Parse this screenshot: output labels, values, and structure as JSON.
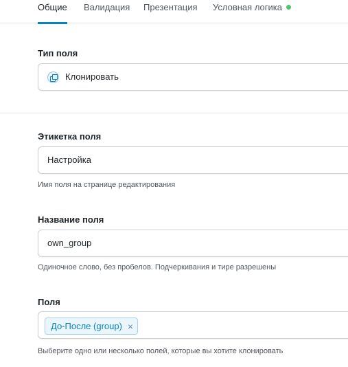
{
  "tabs": [
    {
      "label": "Общие",
      "active": true
    },
    {
      "label": "Валидация"
    },
    {
      "label": "Презентация"
    },
    {
      "label": "Условная логика",
      "status_dot": true
    }
  ],
  "field_type": {
    "label": "Тип поля",
    "value": "Клонировать",
    "icon": "clone-icon"
  },
  "field_label": {
    "label": "Этикетка поля",
    "value": "Настройка",
    "help": "Имя поля на странице редактирования"
  },
  "field_name": {
    "label": "Название поля",
    "value": "own_group",
    "help": "Одиночное слово, без пробелов. Подчеркивания и тире разрешены"
  },
  "fields": {
    "label": "Поля",
    "chips": [
      "До-После (group)"
    ],
    "remove_glyph": "×",
    "help": "Выберите одно или несколько полей, которые вы хотите клонировать"
  },
  "colors": {
    "accent": "#0783be",
    "status_dot": "#52c26e"
  }
}
